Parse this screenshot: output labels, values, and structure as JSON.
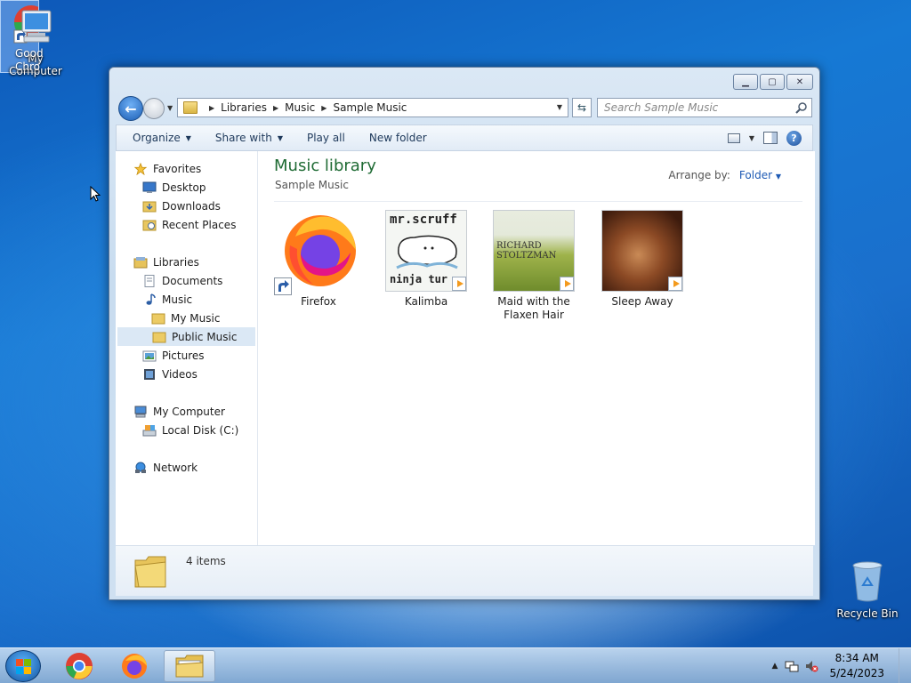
{
  "desktop": {
    "icons": {
      "my_computer": "My Computer",
      "recycle_bin": "Recycle Bin",
      "chrome_partial": "Good\nChro"
    }
  },
  "window": {
    "breadcrumb": [
      "Libraries",
      "Music",
      "Sample Music"
    ],
    "search_placeholder": "Search Sample Music",
    "toolbar": {
      "organize": "Organize",
      "share_with": "Share with",
      "play_all": "Play all",
      "new_folder": "New folder"
    },
    "nav": {
      "favorites": "Favorites",
      "desktop": "Desktop",
      "downloads": "Downloads",
      "recent_places": "Recent Places",
      "libraries": "Libraries",
      "documents": "Documents",
      "music": "Music",
      "my_music": "My Music",
      "public_music": "Public Music",
      "pictures": "Pictures",
      "videos": "Videos",
      "my_computer": "My Computer",
      "local_disk": "Local Disk (C:)",
      "network": "Network"
    },
    "content": {
      "title": "Music library",
      "subtitle": "Sample Music",
      "arrange_label": "Arrange by:",
      "arrange_value": "Folder",
      "items": [
        {
          "label": "Firefox"
        },
        {
          "label": "Kalimba",
          "art_text": "mr.scruff",
          "art_text2": "ninja tur"
        },
        {
          "label": "Maid with the Flaxen Hair",
          "art_text": "RICHARD STOLTZMAN"
        },
        {
          "label": "Sleep Away"
        }
      ]
    },
    "details": {
      "count": "4 items"
    }
  },
  "taskbar": {
    "time": "8:34 AM",
    "date": "5/24/2023"
  }
}
